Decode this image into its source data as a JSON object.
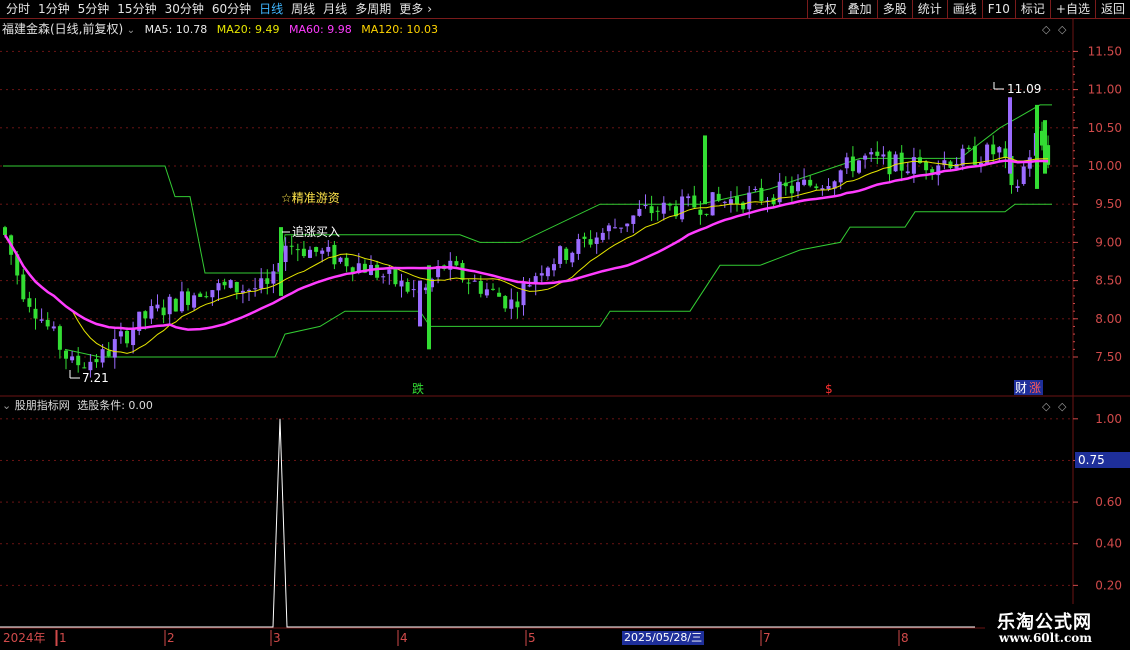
{
  "toolbar": {
    "periods": [
      "分时",
      "1分钟",
      "5分钟",
      "15分钟",
      "30分钟",
      "60分钟",
      "日线",
      "周线",
      "月线",
      "多周期",
      "更多"
    ],
    "active_period": "日线",
    "actions": [
      "复权",
      "叠加",
      "多股",
      "统计",
      "画线",
      "F10",
      "标记",
      "+自选",
      "返回"
    ]
  },
  "main_panel": {
    "title": "福建金森(日线,前复权)",
    "ma": [
      {
        "label": "MA5: 10.78",
        "color": "#e8e8e8"
      },
      {
        "label": "MA20: 9.49",
        "color": "#e6e600"
      },
      {
        "label": "MA60: 9.98",
        "color": "#ff3cff"
      },
      {
        "label": "MA120: 10.03",
        "color": "#ffd400"
      }
    ],
    "annotations": {
      "jingzhun": "☆精准游资",
      "zhuizhang": "追涨买入",
      "low_label": "7.21",
      "high_label": "11.09",
      "marker_die": "跌",
      "marker_s": "$",
      "marker_cai": "财",
      "marker_zhang": "涨"
    },
    "y_ticks": [
      "11.50",
      "11.00",
      "10.50",
      "10.00",
      "9.50",
      "9.00",
      "8.50",
      "8.00",
      "7.50"
    ]
  },
  "indicator_panel": {
    "title": "股朋指标网",
    "condition": "选股条件: 0.00",
    "cursor_value": "0.75",
    "y_ticks": [
      "1.00",
      "0.80",
      "0.60",
      "0.40",
      "0.20"
    ]
  },
  "time_axis": {
    "year_label": "2024年",
    "months": [
      "1",
      "2",
      "3",
      "4",
      "5",
      "7",
      "8"
    ],
    "cursor_date": "2025/05/28/三"
  },
  "logo": {
    "line1": "乐淘公式网",
    "line2": "www.60lt.com"
  },
  "colors": {
    "up": "#9b6bff",
    "down": "#33dd33",
    "grid": "#6b1414",
    "axis_text": "#d04a4a",
    "ma5": "#e8e8e8",
    "ma20": "#e6e600",
    "ma60": "#ff3cff",
    "channel": "#33cc33"
  },
  "chart_data": {
    "type": "candlestick",
    "price_range": [
      7.0,
      11.75
    ],
    "indicator_range": [
      0.0,
      1.1
    ],
    "indicator_signal": {
      "value": 1.0
    },
    "annotated_low": 7.21,
    "annotated_high": 11.09
  }
}
